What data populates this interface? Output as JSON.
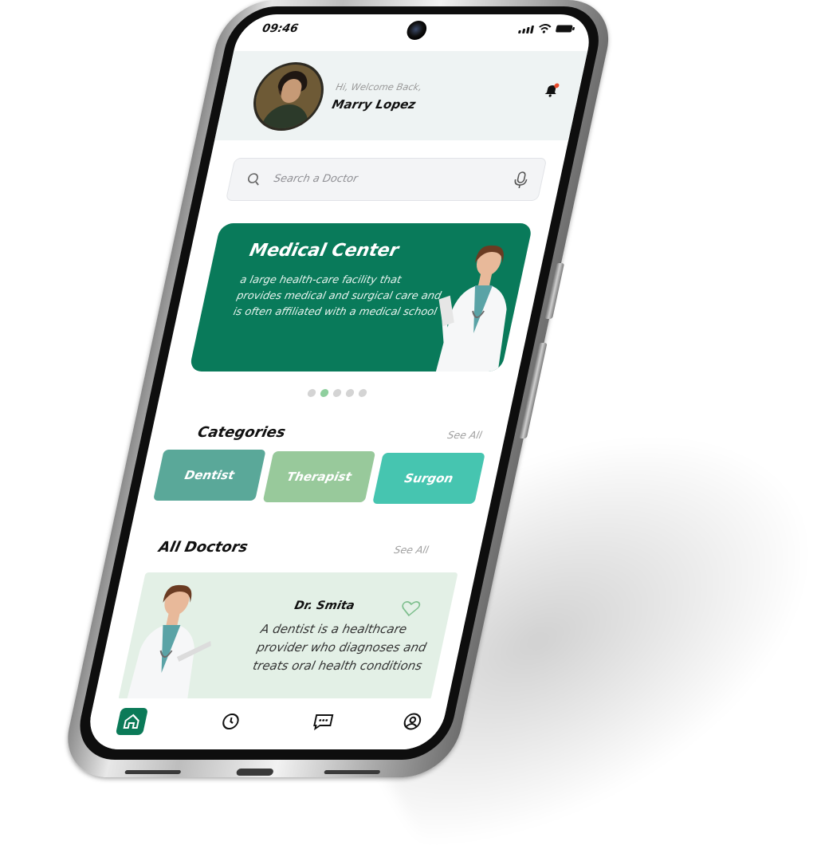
{
  "status_bar": {
    "time": "09:46"
  },
  "header": {
    "greeting": "Hi, Welcome Back,",
    "user_name": "Marry Lopez"
  },
  "search": {
    "placeholder": "Search a Doctor"
  },
  "banner": {
    "title": "Medical Center",
    "description": "a large health-care facility that provides medical and surgical care and is often affiliated with a medical school",
    "carousel": {
      "count": 5,
      "active_index": 1
    }
  },
  "categories": {
    "title": "Categories",
    "see_all": "See All",
    "items": [
      {
        "label": "Dentist",
        "color": "#5aa899"
      },
      {
        "label": "Therapist",
        "color": "#98c99b"
      },
      {
        "label": "Surgon",
        "color": "#46c5b0"
      }
    ]
  },
  "doctors": {
    "title": "All Doctors",
    "see_all": "See All",
    "items": [
      {
        "name": "Dr. Smita",
        "description": "A dentist is a healthcare provider who diagnoses and treats oral health conditions"
      }
    ]
  },
  "tabbar": {
    "tabs": [
      {
        "icon": "home-icon",
        "active": true
      },
      {
        "icon": "clock-icon",
        "active": false
      },
      {
        "icon": "chat-icon",
        "active": false
      },
      {
        "icon": "profile-icon",
        "active": false
      }
    ]
  },
  "colors": {
    "primary": "#097a5a",
    "header_bg": "#eef3f3",
    "card_bg": "#e3f0e6",
    "dot_active": "#8fcf9e",
    "notification_dot": "#e84b2c"
  }
}
